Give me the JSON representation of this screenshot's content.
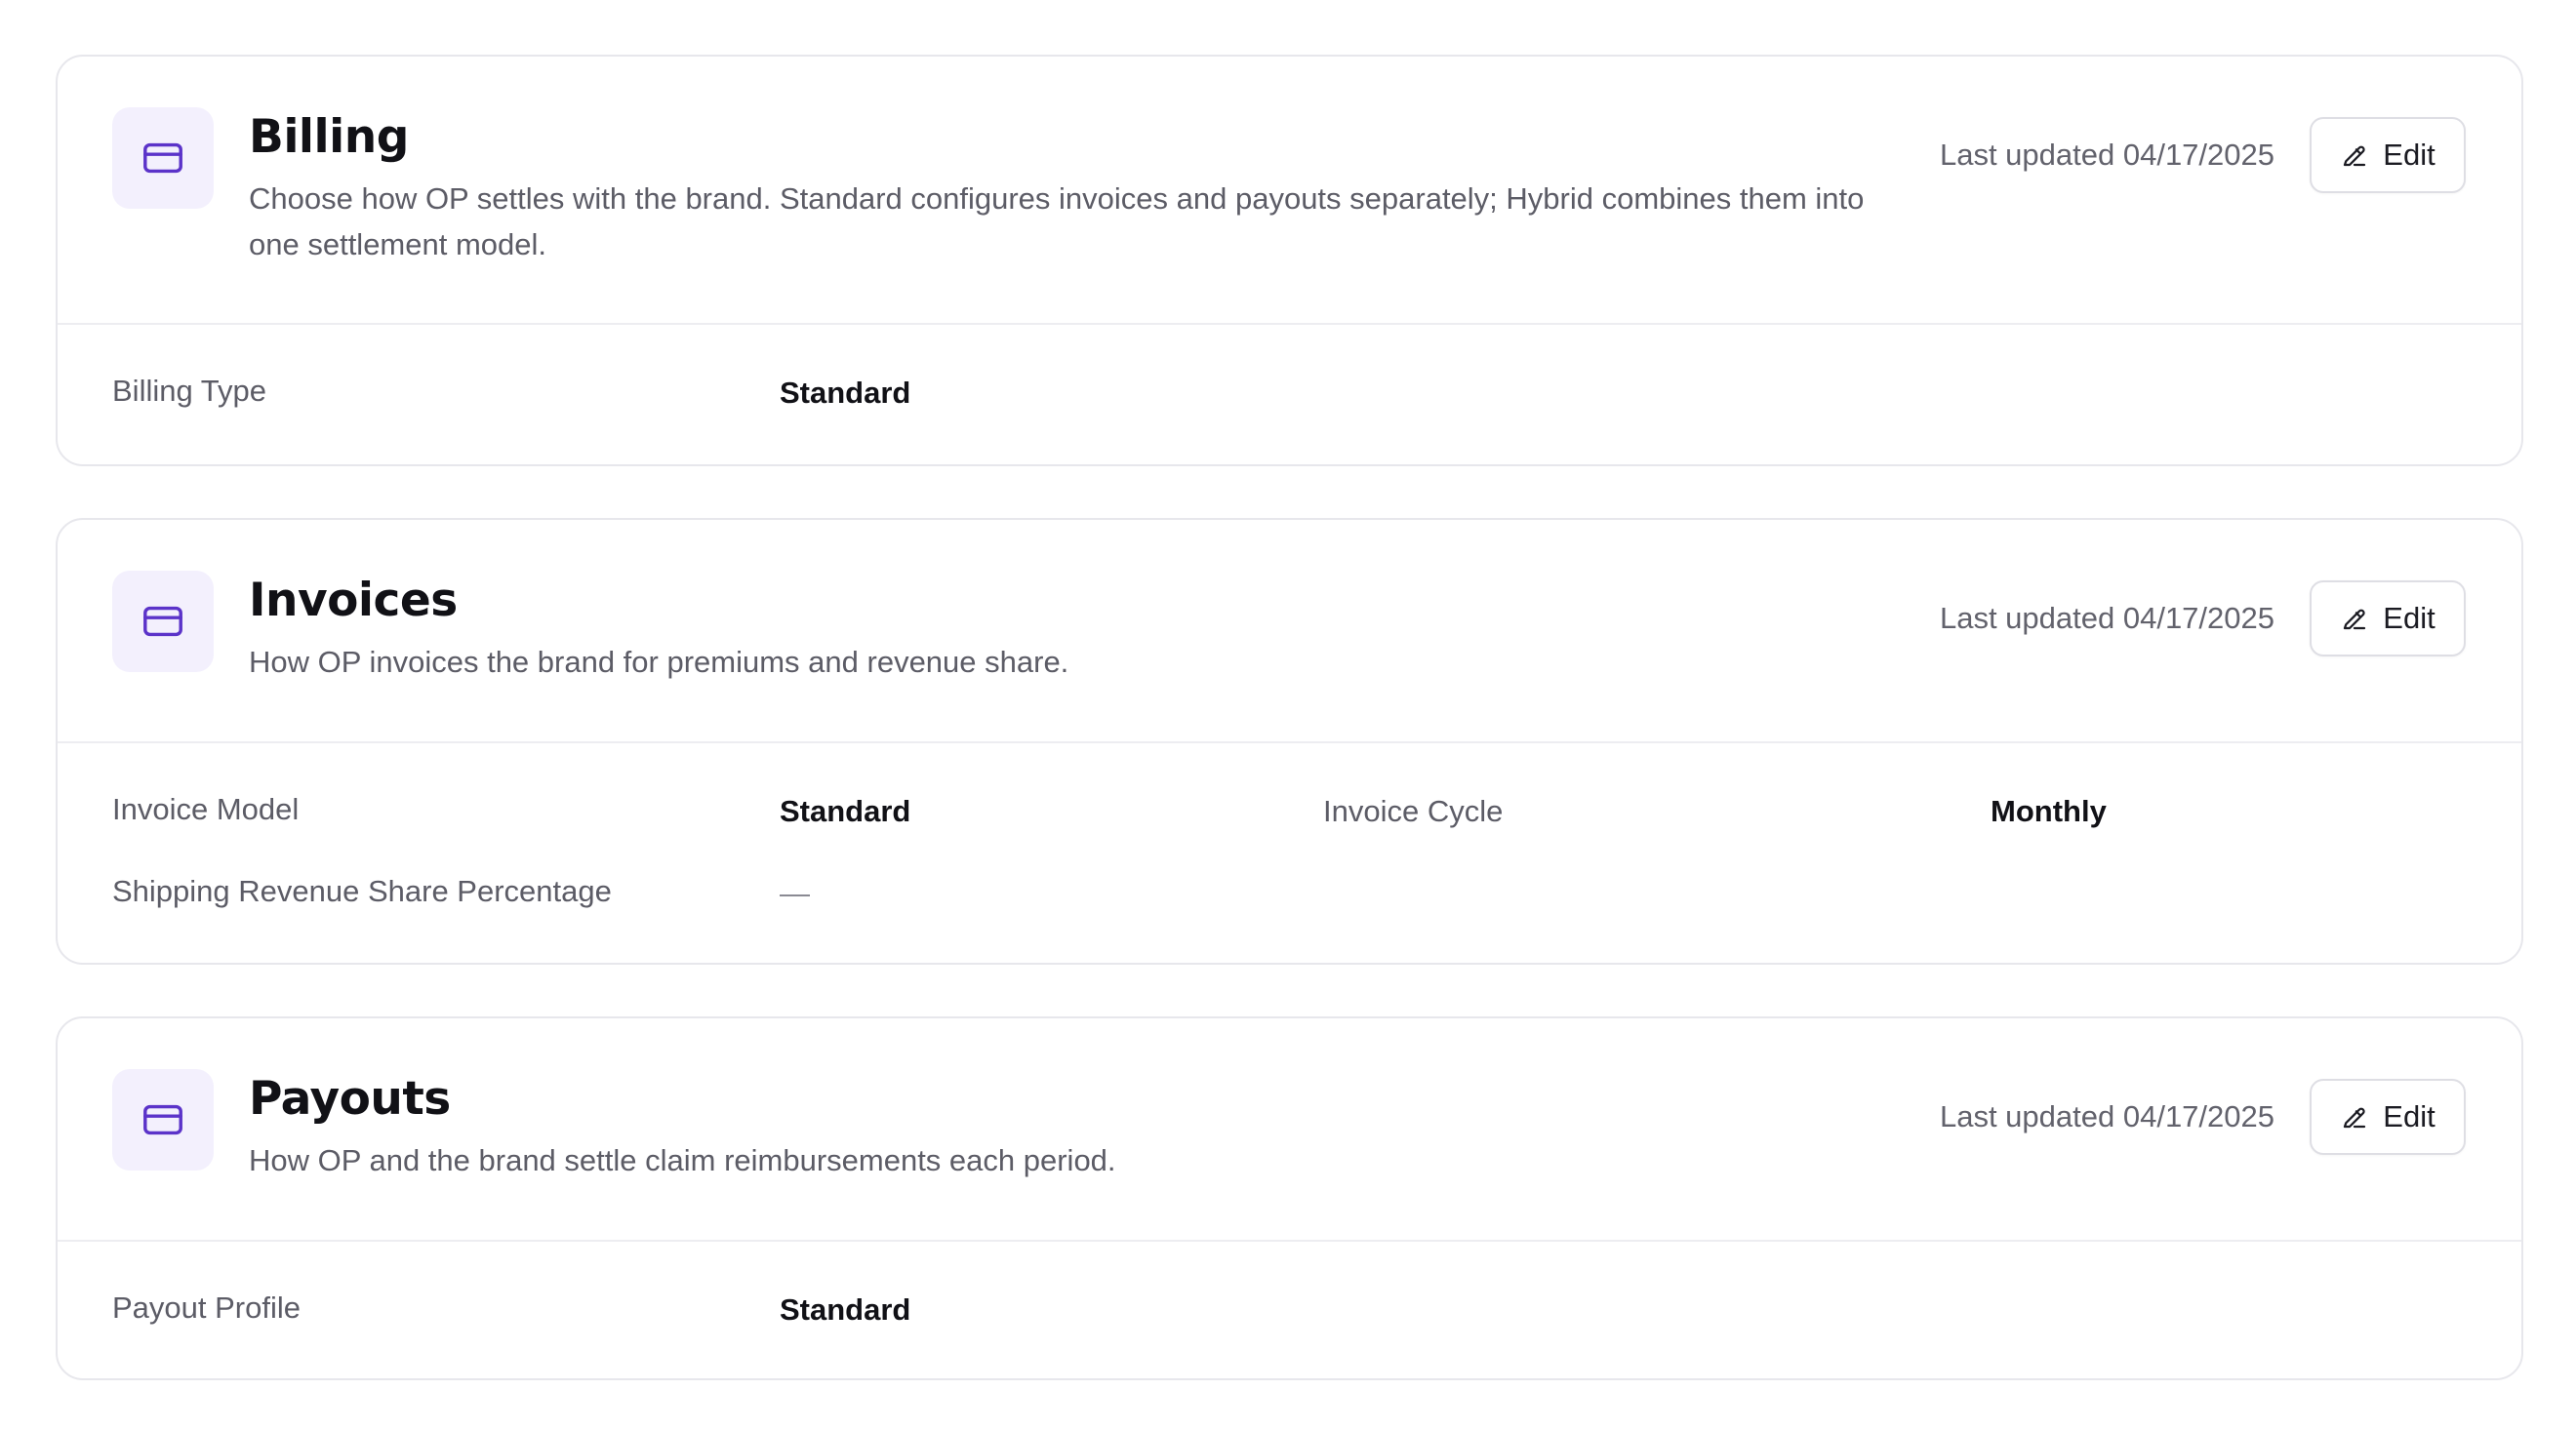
{
  "colors": {
    "accent": "#5b33c9",
    "icon_tile_bg": "#f3f0fd",
    "border": "#e7e7ec",
    "muted_text": "#5c5c66"
  },
  "sections": {
    "billing": {
      "icon": "credit-card-icon",
      "title": "Billing",
      "description": "Choose how OP settles with the brand. Standard configures invoices and payouts separately; Hybrid combines them into one settlement model.",
      "last_updated": "Last updated 04/17/2025",
      "edit_label": "Edit",
      "fields": [
        {
          "label": "Billing Type",
          "value": "Standard"
        }
      ]
    },
    "invoices": {
      "icon": "credit-card-icon",
      "title": "Invoices",
      "description": "How OP invoices the brand for premiums and revenue share.",
      "last_updated": "Last updated 04/17/2025",
      "edit_label": "Edit",
      "fields": [
        {
          "label": "Invoice Model",
          "value": "Standard"
        },
        {
          "label": "Invoice Cycle",
          "value": "Monthly"
        },
        {
          "label": "Shipping Revenue Share Percentage",
          "value": "—"
        }
      ]
    },
    "payouts": {
      "icon": "credit-card-icon",
      "title": "Payouts",
      "description": "How OP and the brand settle claim reimbursements each period.",
      "last_updated": "Last updated 04/17/2025",
      "edit_label": "Edit",
      "fields": [
        {
          "label": "Payout Profile",
          "value": "Standard"
        }
      ]
    }
  }
}
